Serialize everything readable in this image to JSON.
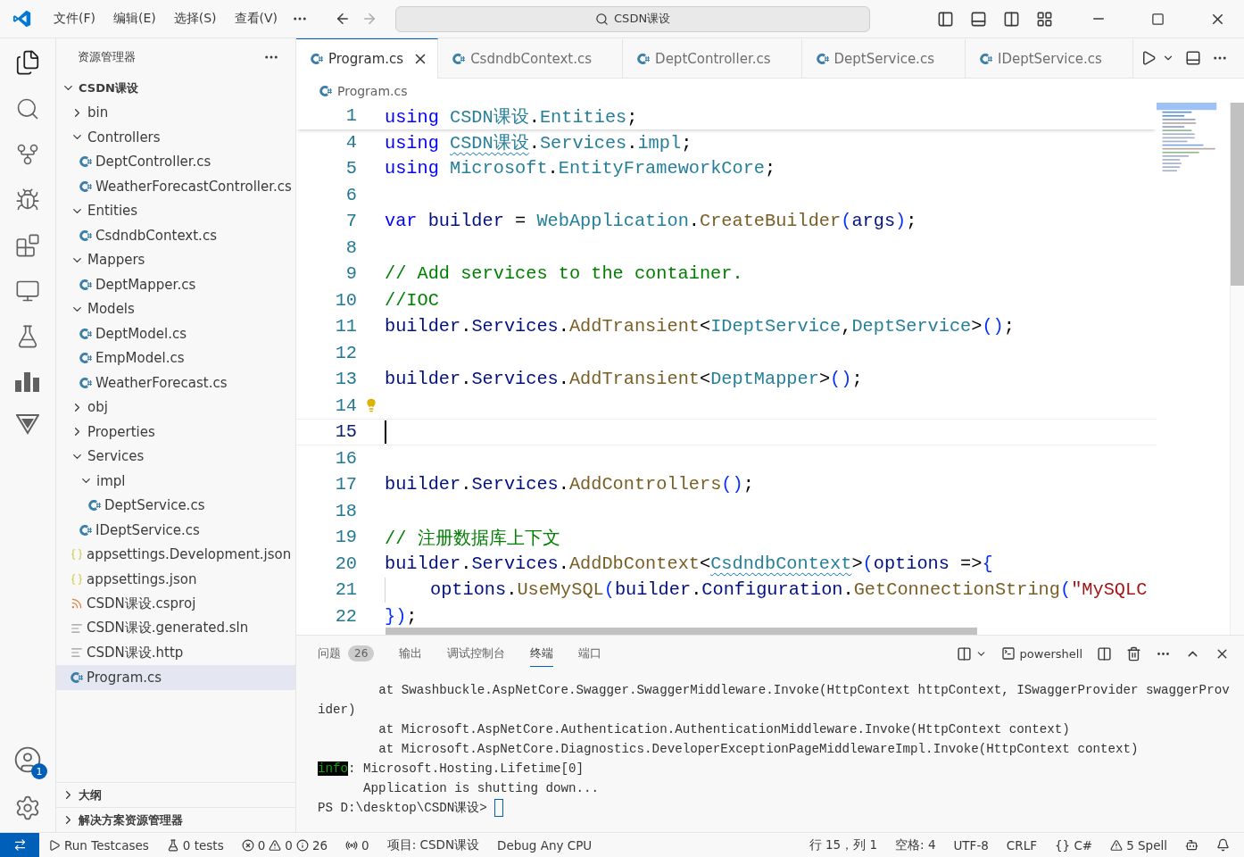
{
  "title_bar": {
    "menus": [
      "文件(F)",
      "编辑(E)",
      "选择(S)",
      "查看(V)"
    ],
    "search": "CSDN课设"
  },
  "activity_bar": {
    "account_badge": "1"
  },
  "explorer": {
    "title": "资源管理器",
    "tree": [
      {
        "label": "CSDN课设",
        "kind": "root",
        "expanded": true,
        "selected": false,
        "children": [
          {
            "label": "bin",
            "kind": "folder",
            "expanded": false,
            "selected": false
          },
          {
            "label": "Controllers",
            "kind": "folder",
            "expanded": true,
            "selected": false,
            "children": [
              {
                "label": "DeptController.cs",
                "kind": "cs",
                "selected": false
              },
              {
                "label": "WeatherForecastController.cs",
                "kind": "cs",
                "selected": false
              }
            ]
          },
          {
            "label": "Entities",
            "kind": "folder",
            "expanded": true,
            "selected": false,
            "children": [
              {
                "label": "CsdndbContext.cs",
                "kind": "cs",
                "selected": false
              }
            ]
          },
          {
            "label": "Mappers",
            "kind": "folder",
            "expanded": true,
            "selected": false,
            "children": [
              {
                "label": "DeptMapper.cs",
                "kind": "cs",
                "selected": false
              }
            ]
          },
          {
            "label": "Models",
            "kind": "folder",
            "expanded": true,
            "selected": false,
            "children": [
              {
                "label": "DeptModel.cs",
                "kind": "cs",
                "selected": false
              },
              {
                "label": "EmpModel.cs",
                "kind": "cs",
                "selected": false
              },
              {
                "label": "WeatherForecast.cs",
                "kind": "cs",
                "selected": false
              }
            ]
          },
          {
            "label": "obj",
            "kind": "folder",
            "expanded": false,
            "selected": false
          },
          {
            "label": "Properties",
            "kind": "folder",
            "expanded": false,
            "selected": false
          },
          {
            "label": "Services",
            "kind": "folder",
            "expanded": true,
            "selected": false,
            "children": [
              {
                "label": "impl",
                "kind": "folder",
                "expanded": true,
                "selected": false,
                "children": [
                  {
                    "label": "DeptService.cs",
                    "kind": "cs",
                    "selected": false
                  }
                ]
              },
              {
                "label": "IDeptService.cs",
                "kind": "cs",
                "selected": false
              }
            ]
          },
          {
            "label": "appsettings.Development.json",
            "kind": "json",
            "selected": false
          },
          {
            "label": "appsettings.json",
            "kind": "json",
            "selected": false
          },
          {
            "label": "CSDN课设.csproj",
            "kind": "rss",
            "selected": false
          },
          {
            "label": "CSDN课设.generated.sln",
            "kind": "text",
            "selected": false
          },
          {
            "label": "CSDN课设.http",
            "kind": "text",
            "selected": false
          },
          {
            "label": "Program.cs",
            "kind": "cs",
            "selected": true
          }
        ]
      }
    ],
    "sections": [
      {
        "label": "大纲",
        "expanded": false
      },
      {
        "label": "解决方案资源管理器",
        "expanded": false
      }
    ]
  },
  "tabs": [
    {
      "label": "Program.cs",
      "selected": true
    },
    {
      "label": "CsdndbContext.cs",
      "selected": false
    },
    {
      "label": "DeptController.cs",
      "selected": false
    },
    {
      "label": "DeptService.cs",
      "selected": false
    },
    {
      "label": "IDeptService.cs",
      "selected": false
    }
  ],
  "breadcrumb": "Program.cs",
  "editor": {
    "sticky": {
      "number": "1",
      "tokens": [
        {
          "kind": "kw",
          "text": "using "
        },
        {
          "kind": "type",
          "text": "CSDN课设"
        },
        {
          "kind": "plain",
          "text": "."
        },
        {
          "kind": "type",
          "text": "Entities"
        },
        {
          "kind": "plain",
          "text": ";"
        }
      ]
    },
    "lines": [
      {
        "number": "4",
        "current": false,
        "lightbulb": false,
        "tokens": [
          {
            "kind": "kw",
            "text": "using "
          },
          {
            "kind": "type",
            "text": "CSDN课设",
            "squiggle": true
          },
          {
            "kind": "plain",
            "text": "."
          },
          {
            "kind": "type",
            "text": "Services"
          },
          {
            "kind": "plain",
            "text": "."
          },
          {
            "kind": "type",
            "text": "impl"
          },
          {
            "kind": "plain",
            "text": ";"
          }
        ]
      },
      {
        "number": "5",
        "current": false,
        "lightbulb": false,
        "tokens": [
          {
            "kind": "kw",
            "text": "using "
          },
          {
            "kind": "type",
            "text": "Microsoft"
          },
          {
            "kind": "plain",
            "text": "."
          },
          {
            "kind": "type",
            "text": "EntityFrameworkCore"
          },
          {
            "kind": "plain",
            "text": ";"
          }
        ]
      },
      {
        "number": "6",
        "current": false,
        "lightbulb": false
      },
      {
        "number": "7",
        "current": false,
        "lightbulb": false,
        "tokens": [
          {
            "kind": "kw",
            "text": "var "
          },
          {
            "kind": "var",
            "text": "builder"
          },
          {
            "kind": "plain",
            "text": " = "
          },
          {
            "kind": "type",
            "text": "WebApplication"
          },
          {
            "kind": "plain",
            "text": "."
          },
          {
            "kind": "fn",
            "text": "CreateBuilder"
          },
          {
            "kind": "bracket",
            "text": "("
          },
          {
            "kind": "var",
            "text": "args"
          },
          {
            "kind": "bracket",
            "text": ")"
          },
          {
            "kind": "plain",
            "text": ";"
          }
        ]
      },
      {
        "number": "8",
        "current": false,
        "lightbulb": false
      },
      {
        "number": "9",
        "current": false,
        "lightbulb": false,
        "tokens": [
          {
            "kind": "comment",
            "text": "// Add services to the container."
          }
        ]
      },
      {
        "number": "10",
        "current": false,
        "lightbulb": false,
        "tokens": [
          {
            "kind": "comment",
            "text": "//IOC"
          }
        ]
      },
      {
        "number": "11",
        "current": false,
        "lightbulb": false,
        "tokens": [
          {
            "kind": "var",
            "text": "builder"
          },
          {
            "kind": "plain",
            "text": "."
          },
          {
            "kind": "var",
            "text": "Services"
          },
          {
            "kind": "plain",
            "text": "."
          },
          {
            "kind": "fn",
            "text": "AddTransient"
          },
          {
            "kind": "plain",
            "text": "<"
          },
          {
            "kind": "type",
            "text": "IDeptService"
          },
          {
            "kind": "plain",
            "text": ","
          },
          {
            "kind": "type",
            "text": "DeptService"
          },
          {
            "kind": "plain",
            "text": ">"
          },
          {
            "kind": "bracket",
            "text": "()"
          },
          {
            "kind": "plain",
            "text": ";"
          }
        ]
      },
      {
        "number": "12",
        "current": false,
        "lightbulb": false
      },
      {
        "number": "13",
        "current": false,
        "lightbulb": false,
        "tokens": [
          {
            "kind": "var",
            "text": "builder"
          },
          {
            "kind": "plain",
            "text": "."
          },
          {
            "kind": "var",
            "text": "Services"
          },
          {
            "kind": "plain",
            "text": "."
          },
          {
            "kind": "fn",
            "text": "AddTransient"
          },
          {
            "kind": "plain",
            "text": "<"
          },
          {
            "kind": "type",
            "text": "DeptMapper"
          },
          {
            "kind": "plain",
            "text": ">"
          },
          {
            "kind": "bracket",
            "text": "()"
          },
          {
            "kind": "plain",
            "text": ";"
          }
        ]
      },
      {
        "number": "14",
        "current": false,
        "lightbulb": true
      },
      {
        "number": "15",
        "current": true,
        "lightbulb": false
      },
      {
        "number": "16",
        "current": false,
        "lightbulb": false
      },
      {
        "number": "17",
        "current": false,
        "lightbulb": false,
        "tokens": [
          {
            "kind": "var",
            "text": "builder"
          },
          {
            "kind": "plain",
            "text": "."
          },
          {
            "kind": "var",
            "text": "Services"
          },
          {
            "kind": "plain",
            "text": "."
          },
          {
            "kind": "fn",
            "text": "AddControllers"
          },
          {
            "kind": "bracket",
            "text": "()"
          },
          {
            "kind": "plain",
            "text": ";"
          }
        ]
      },
      {
        "number": "18",
        "current": false,
        "lightbulb": false
      },
      {
        "number": "19",
        "current": false,
        "lightbulb": false,
        "tokens": [
          {
            "kind": "comment",
            "text": "// 注册数据库上下文"
          }
        ]
      },
      {
        "number": "20",
        "current": false,
        "lightbulb": false,
        "tokens": [
          {
            "kind": "var",
            "text": "builder"
          },
          {
            "kind": "plain",
            "text": "."
          },
          {
            "kind": "var",
            "text": "Services"
          },
          {
            "kind": "plain",
            "text": "."
          },
          {
            "kind": "fn",
            "text": "AddDbContext"
          },
          {
            "kind": "plain",
            "text": "<"
          },
          {
            "kind": "type",
            "text": "CsdndbContext",
            "squiggle": true
          },
          {
            "kind": "plain",
            "text": ">"
          },
          {
            "kind": "bracket",
            "text": "("
          },
          {
            "kind": "var",
            "text": "options"
          },
          {
            "kind": "plain",
            "text": " =>"
          },
          {
            "kind": "bracket",
            "text": "{"
          }
        ]
      },
      {
        "number": "21",
        "current": false,
        "lightbulb": false,
        "indent": true,
        "tokens": [
          {
            "kind": "var",
            "text": "options"
          },
          {
            "kind": "plain",
            "text": "."
          },
          {
            "kind": "fn",
            "text": "UseMySQL"
          },
          {
            "kind": "bracket",
            "text": "("
          },
          {
            "kind": "var",
            "text": "builder"
          },
          {
            "kind": "plain",
            "text": "."
          },
          {
            "kind": "var",
            "text": "Configuration"
          },
          {
            "kind": "plain",
            "text": "."
          },
          {
            "kind": "fn",
            "text": "GetConnectionString"
          },
          {
            "kind": "bracket",
            "text": "("
          },
          {
            "kind": "str",
            "text": "\"MySQLC"
          }
        ]
      },
      {
        "number": "22",
        "current": false,
        "lightbulb": false,
        "tokens": [
          {
            "kind": "bracket",
            "text": "}"
          },
          {
            "kind": "bracket",
            "text": ")"
          },
          {
            "kind": "plain",
            "text": ";"
          }
        ]
      }
    ]
  },
  "panel": {
    "tabs": [
      {
        "label": "问题",
        "badge": "26",
        "selected": false
      },
      {
        "label": "输出",
        "selected": false
      },
      {
        "label": "调试控制台",
        "selected": false
      },
      {
        "label": "终端",
        "selected": true
      },
      {
        "label": "端口",
        "selected": false
      }
    ],
    "shell": "powershell",
    "lines": [
      {
        "kind": "plain",
        "text": "        at Swashbuckle.AspNetCore.Swagger.SwaggerMiddleware.Invoke(HttpContext httpContext, ISwaggerProvider swaggerProvider)"
      },
      {
        "kind": "plain",
        "text": "        at Microsoft.AspNetCore.Authentication.AuthenticationMiddleware.Invoke(HttpContext context)"
      },
      {
        "kind": "plain",
        "text": "        at Microsoft.AspNetCore.Diagnostics.DeveloperExceptionPageMiddlewareImpl.Invoke(HttpContext context)"
      },
      {
        "kind": "info",
        "tag": "info",
        "text": ": Microsoft.Hosting.Lifetime[0]"
      },
      {
        "kind": "plain",
        "text": "      Application is shutting down..."
      },
      {
        "kind": "prompt",
        "text": "PS D:\\desktop\\CSDN课设> "
      }
    ]
  },
  "status_bar": {
    "left": [
      {
        "kind": "run",
        "text": "Run Testcases"
      },
      {
        "kind": "tests",
        "text": "0 tests"
      },
      {
        "kind": "problems",
        "errors": "0",
        "warnings": "0",
        "infos": "26"
      },
      {
        "kind": "ports",
        "text": "0"
      },
      {
        "kind": "text",
        "text": "项目: CSDN课设"
      },
      {
        "kind": "text",
        "text": "Debug Any CPU"
      }
    ],
    "right": [
      {
        "kind": "text",
        "text": "行 15，列 1"
      },
      {
        "kind": "text",
        "text": "空格: 4"
      },
      {
        "kind": "text",
        "text": "UTF-8"
      },
      {
        "kind": "text",
        "text": "CRLF"
      },
      {
        "kind": "lang",
        "symbol": "{}",
        "text": "C#"
      },
      {
        "kind": "spell",
        "text": "5 Spell"
      }
    ]
  }
}
